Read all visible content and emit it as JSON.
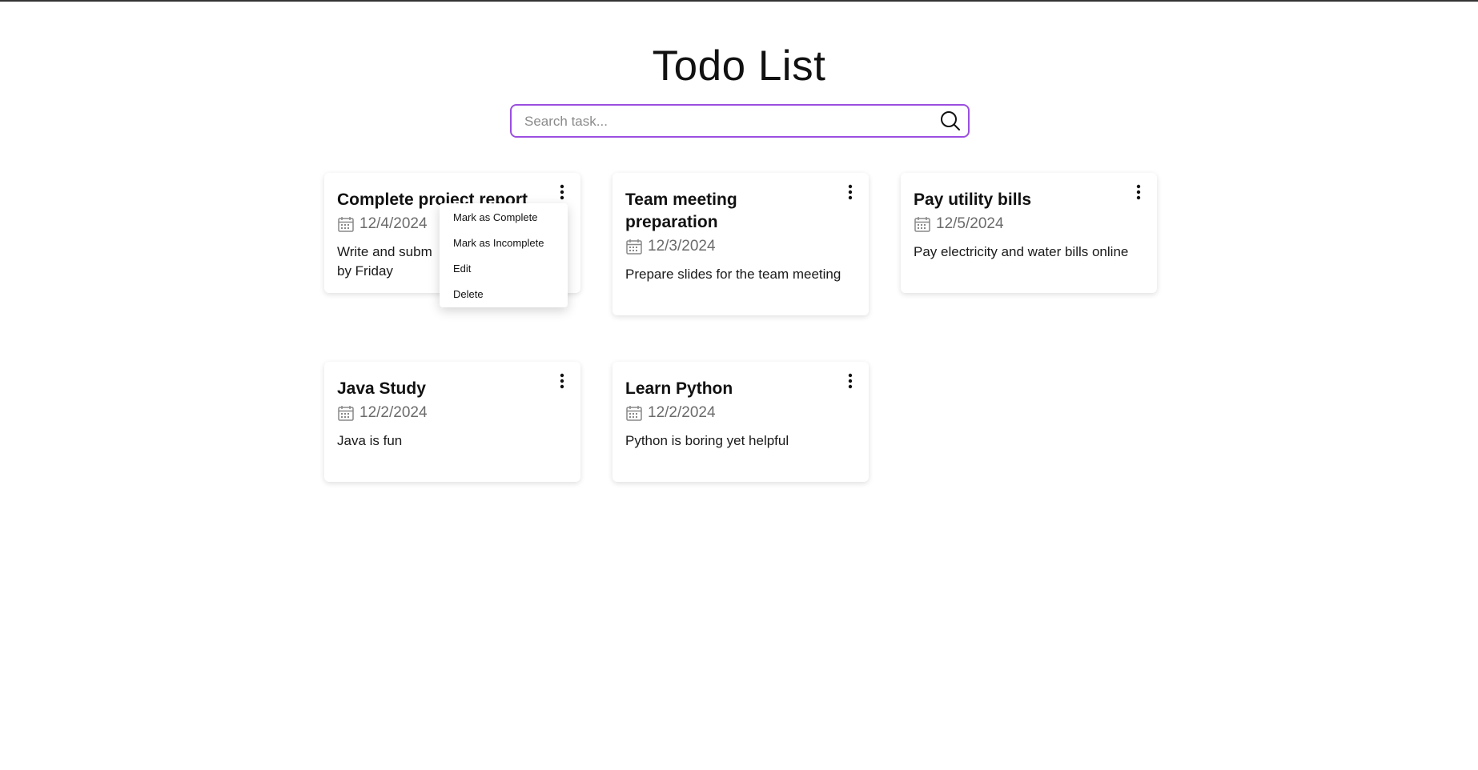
{
  "page": {
    "title": "Todo List"
  },
  "search": {
    "placeholder": "Search task...",
    "value": "",
    "icon": "search-icon"
  },
  "accent_color": "#9b4fe0",
  "tasks": [
    {
      "title": "Complete project report",
      "date": "12/4/2024",
      "description": "Write and subm",
      "description_continued": "by Friday"
    },
    {
      "title": "Team meeting preparation",
      "date": "12/3/2024",
      "description": "Prepare slides for the team meeting"
    },
    {
      "title": "Pay utility bills",
      "date": "12/5/2024",
      "description": "Pay electricity and water bills online"
    },
    {
      "title": "Java Study",
      "date": "12/2/2024",
      "description": "Java is fun"
    },
    {
      "title": "Learn Python",
      "date": "12/2/2024",
      "description": "Python is boring yet helpful"
    }
  ],
  "context_menu": {
    "items": [
      {
        "label": "Mark as Complete"
      },
      {
        "label": "Mark as Incomplete"
      },
      {
        "label": "Edit"
      },
      {
        "label": "Delete"
      }
    ]
  }
}
